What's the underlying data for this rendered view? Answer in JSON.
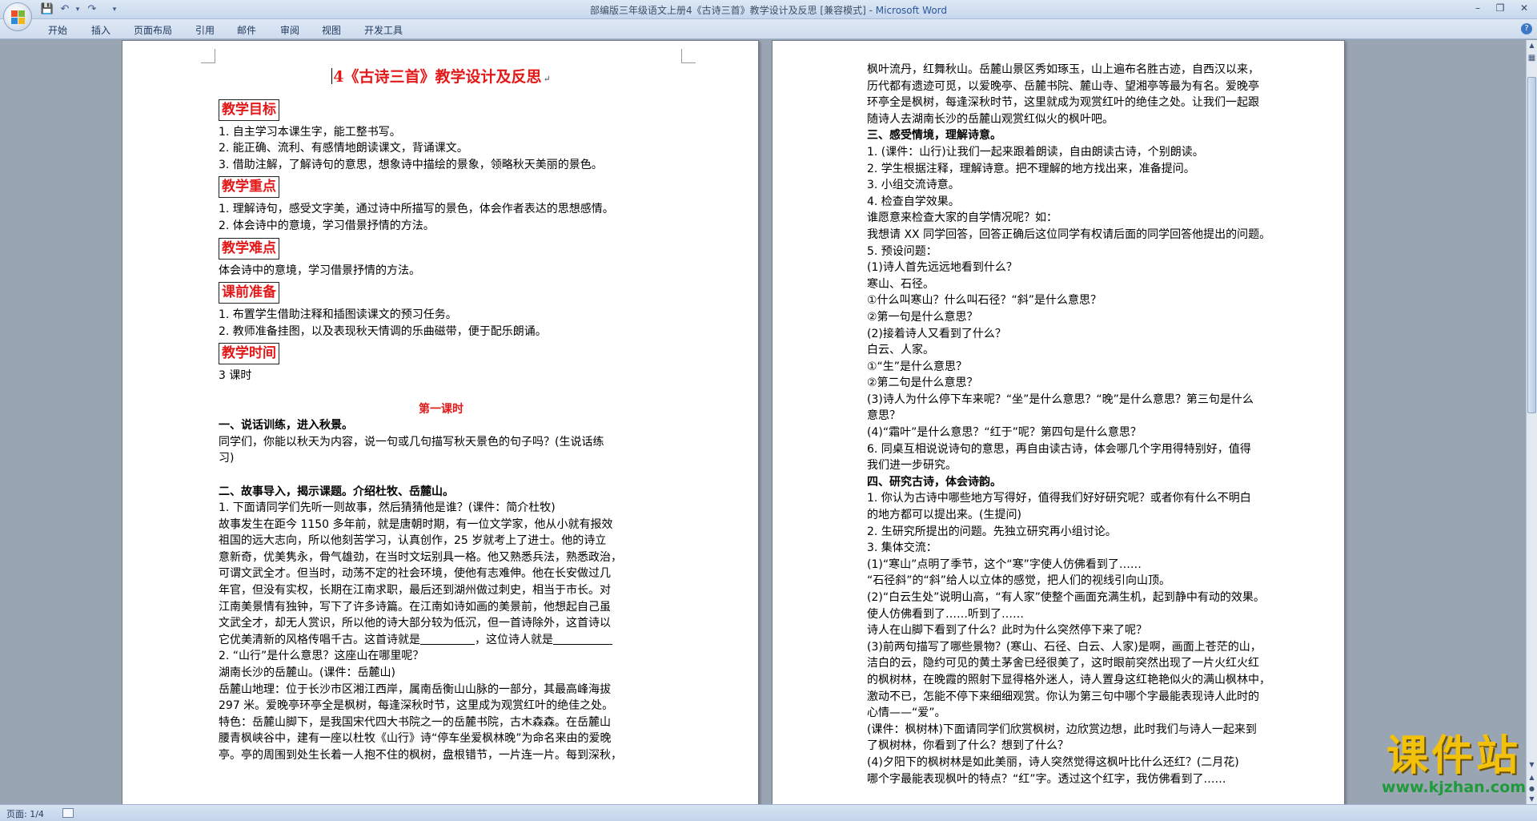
{
  "window": {
    "title": "部编版三年级语文上册4《古诗三首》教学设计及反思 [兼容模式] - ",
    "app_name": "Microsoft Word"
  },
  "ribbon": {
    "tabs": [
      "开始",
      "插入",
      "页面布局",
      "引用",
      "邮件",
      "审阅",
      "视图",
      "开发工具"
    ]
  },
  "page1": {
    "title": "4《古诗三首》教学设计及反思",
    "sections": [
      {
        "heading": "教学目标",
        "lines": [
          "1. 自主学习本课生字，能工整书写。",
          "2. 能正确、流利、有感情地朗读课文，背诵课文。",
          "3. 借助注解，了解诗句的意思，想象诗中描绘的景象，领略秋天美丽的景色。"
        ]
      },
      {
        "heading": "教学重点",
        "lines": [
          "1. 理解诗句，感受文字美，通过诗中所描写的景色，体会作者表达的思想感情。",
          "2. 体会诗中的意境，学习借景抒情的方法。"
        ]
      },
      {
        "heading": "教学难点",
        "lines": [
          "体会诗中的意境，学习借景抒情的方法。"
        ]
      },
      {
        "heading": "课前准备",
        "lines": [
          "1. 布置学生借助注释和插图读课文的预习任务。",
          "2. 教师准备挂图，以及表现秋天情调的乐曲磁带，便于配乐朗诵。"
        ]
      },
      {
        "heading": "教学时间",
        "lines": [
          "3 课时"
        ]
      }
    ],
    "lesson_title": "第一课时",
    "part1_heading": "一、说话训练，进入秋景。",
    "part1_text": [
      "同学们，你能以秋天为内容，说一句或几句描写秋天景色的句子吗？(生说话练",
      "习)"
    ],
    "part2_heading": "二、故事导入，揭示课题。介绍杜牧、岳麓山。",
    "part2_lines": [
      "1. 下面请同学们先听一则故事，然后猜猜他是谁？(课件：简介杜牧)",
      "故事发生在距今 1150 多年前，就是唐朝时期，有一位文学家，他从小就有报效",
      "祖国的远大志向，所以他刻苦学习，认真创作，25 岁就考上了进士。他的诗立",
      "意新奇，优美隽永，骨气雄劲，在当时文坛别具一格。他又熟悉兵法，熟悉政治，",
      "可谓文武全才。但当时，动荡不定的社会环境，使他有志难伸。他在长安做过几",
      "年官，但没有实权，长期在江南求职，最后还到湖州做过刺史，相当于市长。对",
      "江南美景情有独钟，写下了许多诗篇。在江南如诗如画的美景前，他想起自己虽",
      "文武全才，却无人赏识，所以他的诗大部分较为低沉，但一首诗除外，这首诗以",
      "它优美清新的风格传唱千古。"
    ],
    "blank_a": "这首诗就是",
    "blank_b": "，这位诗人就是",
    "part2_lines_b": [
      "2. “山行”是什么意思？这座山在哪里呢？",
      "湖南长沙的岳麓山。(课件：岳麓山)",
      "岳麓山地理：位于长沙市区湘江西岸，属南岳衡山山脉的一部分，其最高峰海拔",
      "297 米。爱晚亭环亭全是枫树，每逢深秋时节，这里成为观赏红叶的绝佳之处。",
      "特色：岳麓山脚下，是我国宋代四大书院之一的岳麓书院，古木森森。在岳麓山",
      "腰青枫峡谷中，建有一座以杜牧《山行》诗“停车坐爱枫林晚”为命名来由的爱晚",
      "亭。亭的周围到处生长着一人抱不住的枫树，盘根错节，一片连一片。每到深秋，"
    ]
  },
  "page2": {
    "lines": [
      {
        "t": "枫叶流丹，红舞秋山。岳麓山景区秀如琢玉，山上遍布名胜古迹，自西汉以来，",
        "b": false
      },
      {
        "t": "历代都有遗迹可觅，以爱晚亭、岳麓书院、麓山寺、望湘亭等最为有名。爱晚亭",
        "b": false
      },
      {
        "t": "环亭全是枫树，每逢深秋时节，这里就成为观赏红叶的绝佳之处。让我们一起跟",
        "b": false
      },
      {
        "t": "随诗人去湖南长沙的岳麓山观赏红似火的枫叶吧。",
        "b": false
      },
      {
        "t": "三、感受情境，理解诗意。",
        "b": true
      },
      {
        "t": "1. (课件：山行)让我们一起来跟着朗读，自由朗读古诗，个别朗读。",
        "b": false
      },
      {
        "t": "2. 学生根据注释，理解诗意。把不理解的地方找出来，准备提问。",
        "b": false
      },
      {
        "t": "3. 小组交流诗意。",
        "b": false
      },
      {
        "t": "4. 检查自学效果。",
        "b": false
      },
      {
        "t": "谁愿意来检查大家的自学情况呢？如：",
        "b": false
      },
      {
        "t": "我想请 XX 同学回答，回答正确后这位同学有权请后面的同学回答他提出的问题。",
        "b": false
      },
      {
        "t": "5. 预设问题：",
        "b": false
      },
      {
        "t": "(1)诗人首先远远地看到什么？",
        "b": false
      },
      {
        "t": "寒山、石径。",
        "b": false
      },
      {
        "t": "①什么叫寒山？什么叫石径？“斜”是什么意思？",
        "b": false
      },
      {
        "t": "②第一句是什么意思？",
        "b": false
      },
      {
        "t": "(2)接着诗人又看到了什么？",
        "b": false
      },
      {
        "t": "白云、人家。",
        "b": false
      },
      {
        "t": "①“生”是什么意思？",
        "b": false
      },
      {
        "t": "②第二句是什么意思？",
        "b": false
      },
      {
        "t": "(3)诗人为什么停下车来呢？“坐”是什么意思？“晚”是什么意思？第三句是什么",
        "b": false
      },
      {
        "t": "意思？",
        "b": false
      },
      {
        "t": "(4)“霜叶”是什么意思？“红于”呢？第四句是什么意思？",
        "b": false
      },
      {
        "t": "6. 同桌互相说说诗句的意思，再自由读古诗，体会哪几个字用得特别好，值得",
        "b": false
      },
      {
        "t": "我们进一步研究。",
        "b": false
      },
      {
        "t": "四、研究古诗，体会诗韵。",
        "b": true
      },
      {
        "t": "1. 你认为古诗中哪些地方写得好，值得我们好好研究呢？或者你有什么不明白",
        "b": false
      },
      {
        "t": "的地方都可以提出来。(生提问)",
        "b": false
      },
      {
        "t": "2. 生研究所提出的问题。先独立研究再小组讨论。",
        "b": false
      },
      {
        "t": "3. 集体交流：",
        "b": false
      },
      {
        "t": "(1)“寒山”点明了季节，这个“寒”字使人仿佛看到了……",
        "b": false
      },
      {
        "t": "“石径斜”的“斜”给人以立体的感觉，把人们的视线引向山顶。",
        "b": false
      },
      {
        "t": "(2)“白云生处”说明山高，“有人家”使整个画面充满生机，起到静中有动的效果。",
        "b": false
      },
      {
        "t": "使人仿佛看到了……听到了……",
        "b": false
      },
      {
        "t": "诗人在山脚下看到了什么？此时为什么突然停下来了呢？",
        "b": false
      },
      {
        "t": "(3)前两句描写了哪些景物？(寒山、石径、白云、人家)是啊，画面上苍茫的山，",
        "b": false
      },
      {
        "t": "洁白的云，隐约可见的黄土茅舍已经很美了，这时眼前突然出现了一片火红火红",
        "b": false
      },
      {
        "t": "的枫树林，在晚霞的照射下显得格外迷人，诗人置身这红艳艳似火的满山枫林中，",
        "b": false
      },
      {
        "t": "激动不已，怎能不停下来细细观赏。你认为第三句中哪个字最能表现诗人此时的",
        "b": false
      },
      {
        "t": "心情——“爱”。",
        "b": false
      },
      {
        "t": "(课件：枫树林)下面请同学们欣赏枫树，边欣赏边想，此时我们与诗人一起来到",
        "b": false
      },
      {
        "t": "了枫树林，你看到了什么？想到了什么？",
        "b": false
      },
      {
        "t": "(4)夕阳下的枫树林是如此美丽，诗人突然觉得这枫叶比什么还红？(二月花)",
        "b": false
      },
      {
        "t": "哪个字最能表现枫叶的特点？“红”字。透过这个红字，我仿佛看到了……",
        "b": false
      }
    ]
  },
  "status": {
    "page_indicator": "页面: 1/4"
  },
  "watermark": {
    "text": "课件站",
    "url": "www.kjzhan.com"
  }
}
